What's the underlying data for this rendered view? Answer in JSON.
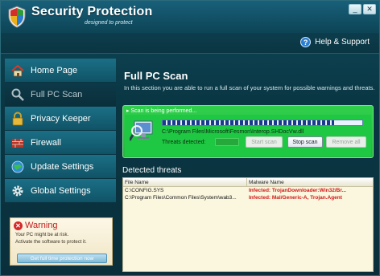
{
  "window": {
    "title": "Security Protection",
    "subtitle": "designed to protect",
    "buttons": {
      "minimize": "_",
      "close": "✕"
    }
  },
  "help": {
    "label": "Help & Support"
  },
  "sidebar": {
    "items": [
      {
        "label": "Home Page",
        "icon": "house-icon"
      },
      {
        "label": "Full PC Scan",
        "icon": "magnifier-icon",
        "active": true
      },
      {
        "label": "Privacy Keeper",
        "icon": "lock-icon"
      },
      {
        "label": "Firewall",
        "icon": "firewall-icon"
      },
      {
        "label": "Update Settings",
        "icon": "globe-icon"
      },
      {
        "label": "Global Settings",
        "icon": "gear-icon"
      }
    ],
    "warning": {
      "title": "Warning",
      "line1": "Your PC might be at risk.",
      "line2": "Activate the software to protect it.",
      "button": "Get full time protection now"
    }
  },
  "main": {
    "title": "Full PC Scan",
    "description": "In this section you are able to run a full scan of your system for possible warnings and threats.",
    "scan": {
      "status": "Scan is being performed...",
      "current_path": "C:\\Program Files\\Microsoft\\Fesmon\\Interop.SHDocVw.dll",
      "threats_label": "Threats detected:",
      "progress": 0.86,
      "buttons": {
        "start": "Start scan",
        "stop": "Stop scan",
        "remove": "Remove all"
      }
    },
    "detected": {
      "title": "Detected threats",
      "columns": [
        "File Name",
        "Malware Name"
      ],
      "rows": [
        {
          "file": "C:\\CONFIG.SYS",
          "malware": "Infected: TrojanDownloader:Win32/Br..."
        },
        {
          "file": "C:\\Program Files\\Common Files\\System\\wab3...",
          "malware": "Infected: Mal/Generic-A, Trojan.Agent"
        }
      ]
    }
  },
  "colors": {
    "scan_green": "#27b43f",
    "threat_red": "#d11717",
    "panel_teal": "#0a3744"
  }
}
